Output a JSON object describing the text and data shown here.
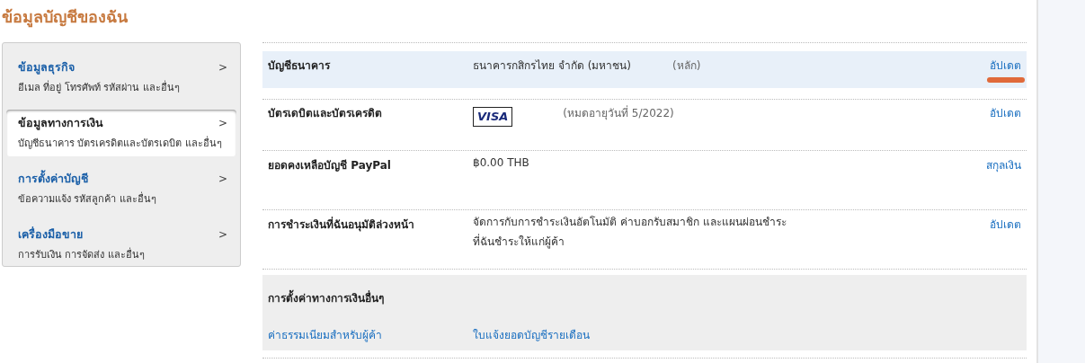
{
  "page_title": "ข้อมูลบัญชีของฉัน",
  "sidebar": {
    "items": [
      {
        "title": "ข้อมูลธุรกิจ",
        "subtitle": "อีเมล ที่อยู่ โทรศัพท์ รหัสผ่าน และอื่นๆ",
        "arrow": ">",
        "selected": false
      },
      {
        "title": "ข้อมูลทางการเงิน",
        "subtitle": "บัญชีธนาคาร บัตรเครดิตและบัตรเดบิต และอื่นๆ",
        "arrow": ">",
        "selected": true
      },
      {
        "title": "การตั้งค่าบัญชี",
        "subtitle": "ข้อความแจ้ง รหัสลูกค้า และอื่นๆ",
        "arrow": ">",
        "selected": false
      },
      {
        "title": "เครื่องมือขาย",
        "subtitle": "การรับเงิน การจัดส่ง และอื่นๆ",
        "arrow": ">",
        "selected": false
      }
    ]
  },
  "rows": [
    {
      "kind": "bank",
      "label": "บัญชีธนาคาร",
      "value": "ธนาคารกสิกรไทย จำกัด (มหาชน)",
      "note": "(หลัก)",
      "action": "อัปเดต",
      "highlighted": true,
      "action_underlined": true
    },
    {
      "kind": "card",
      "label": "บัตรเดบิตและบัตรเครดิต",
      "card_brand": "VISA",
      "note": "(หมดอายุวันที่ 5/2022)",
      "action": "อัปเดต",
      "highlighted": false,
      "action_underlined": false
    },
    {
      "kind": "text",
      "label": "ยอดคงเหลือบัญชี PayPal",
      "value": "฿0.00 THB",
      "action": "สกุลเงิน",
      "highlighted": false,
      "action_underlined": false
    },
    {
      "kind": "text",
      "label": "การชำระเงินที่ฉันอนุมัติล่วงหน้า",
      "value": "จัดการกับการชำระเงินอัตโนมัติ ค่าบอกรับสมาชิก และแผนผ่อนชำระ\nที่ฉันชำระให้แก่ผู้ค้า",
      "action": "อัปเดต",
      "highlighted": false,
      "action_underlined": false
    }
  ],
  "other_settings": {
    "title": "การตั้งค่าทางการเงินอื่นๆ",
    "links": [
      "ค่าธรรมเนียมสำหรับผู้ค้า",
      "ใบแจ้งยอดบัญชีรายเดือน"
    ]
  }
}
